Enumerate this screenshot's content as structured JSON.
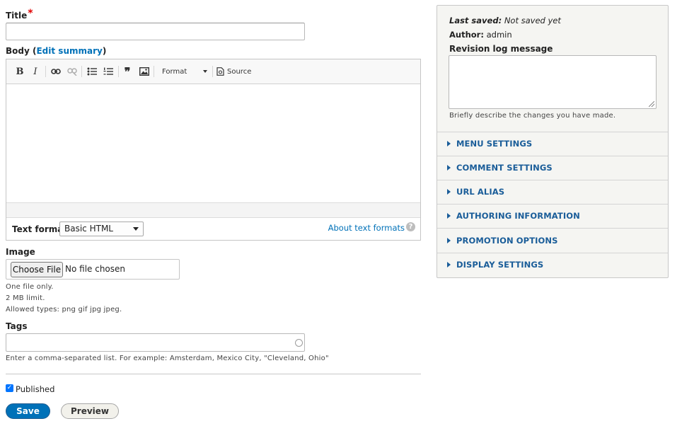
{
  "title_field": {
    "label": "Title",
    "required_mark": "*",
    "value": ""
  },
  "body_field": {
    "label": "Body",
    "edit_summary_link": "Edit summary",
    "toolbar": {
      "bold": "B",
      "italic": "I",
      "quote": "❞",
      "format_label": "Format",
      "source_label": "Source"
    },
    "text_format_label": "Text format",
    "text_format_value": "Basic HTML",
    "about_formats_link": "About text formats",
    "help_glyph": "?"
  },
  "image_field": {
    "label": "Image",
    "choose_button": "Choose File",
    "no_file_text": "No file chosen",
    "descriptions": [
      "One file only.",
      "2 MB limit.",
      "Allowed types: png gif jpg jpeg."
    ]
  },
  "tags_field": {
    "label": "Tags",
    "value": "",
    "description": "Enter a comma-separated list. For example: Amsterdam, Mexico City, \"Cleveland, Ohio\""
  },
  "published": {
    "label": "Published",
    "checked": true
  },
  "actions": {
    "save_label": "Save",
    "preview_label": "Preview"
  },
  "sidebar": {
    "last_saved_label": "Last saved:",
    "last_saved_value": "Not saved yet",
    "author_label": "Author:",
    "author_value": "admin",
    "revision_label": "Revision log message",
    "revision_desc": "Briefly describe the changes you have made.",
    "sections": [
      "MENU SETTINGS",
      "COMMENT SETTINGS",
      "URL ALIAS",
      "AUTHORING INFORMATION",
      "PROMOTION OPTIONS",
      "DISPLAY SETTINGS"
    ]
  },
  "colors": {
    "link": "#0071b8",
    "primary_button": "#0071b8",
    "section_heading": "#1a5d99",
    "required": "#e00000"
  }
}
